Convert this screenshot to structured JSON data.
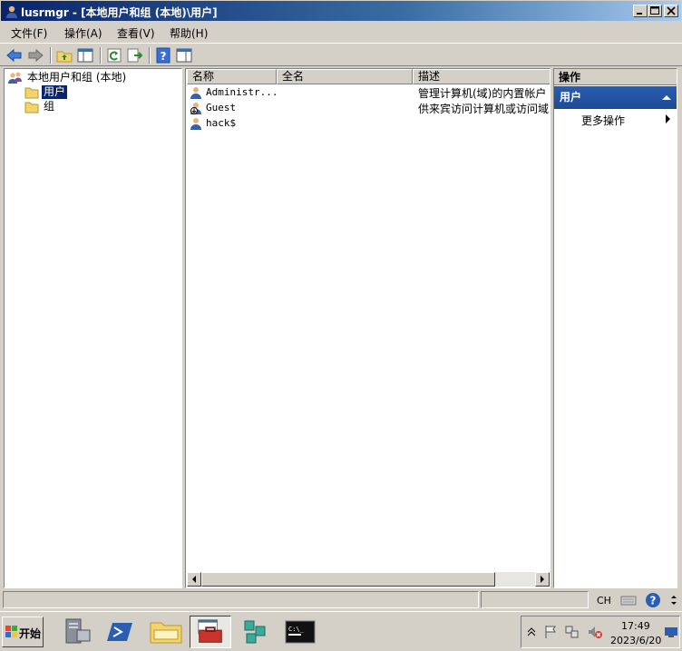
{
  "window": {
    "title": "lusrmgr - [本地用户和组 (本地)\\用户]"
  },
  "menu": {
    "items": [
      "文件(F)",
      "操作(A)",
      "查看(V)",
      "帮助(H)"
    ]
  },
  "toolbar": {
    "icons": [
      "back-arrow-icon",
      "forward-arrow-icon",
      "up-folder-icon",
      "show-hide-tree-icon",
      "refresh-icon",
      "export-list-icon",
      "help-icon",
      "properties-icon"
    ]
  },
  "tree": {
    "root": "本地用户和组 (本地)",
    "children": [
      {
        "label": "用户",
        "selected": true
      },
      {
        "label": "组",
        "selected": false
      }
    ]
  },
  "list": {
    "columns": [
      "名称",
      "全名",
      "描述"
    ],
    "rows": [
      {
        "name": "Administr...",
        "full_name": "",
        "description": "管理计算机(域)的内置帐户"
      },
      {
        "name": "Guest",
        "full_name": "",
        "description": "供来宾访问计算机或访问域"
      },
      {
        "name": "hack$",
        "full_name": "",
        "description": ""
      }
    ]
  },
  "actions": {
    "header": "操作",
    "section": "用户",
    "item": "更多操作"
  },
  "taskbar": {
    "start_label": "开始",
    "apps": [
      "server-manager-icon",
      "powershell-icon",
      "explorer-icon",
      "toolbox-icon",
      "network-icon",
      "cmd-icon"
    ],
    "tray": {
      "language": "CH",
      "time": "17:49",
      "date": "2023/6/20"
    }
  },
  "colors": {
    "title_bar": "#0a246a",
    "selection": "#0a246a",
    "action_section": "#2a5eb2",
    "face": "#d4d0c8"
  }
}
